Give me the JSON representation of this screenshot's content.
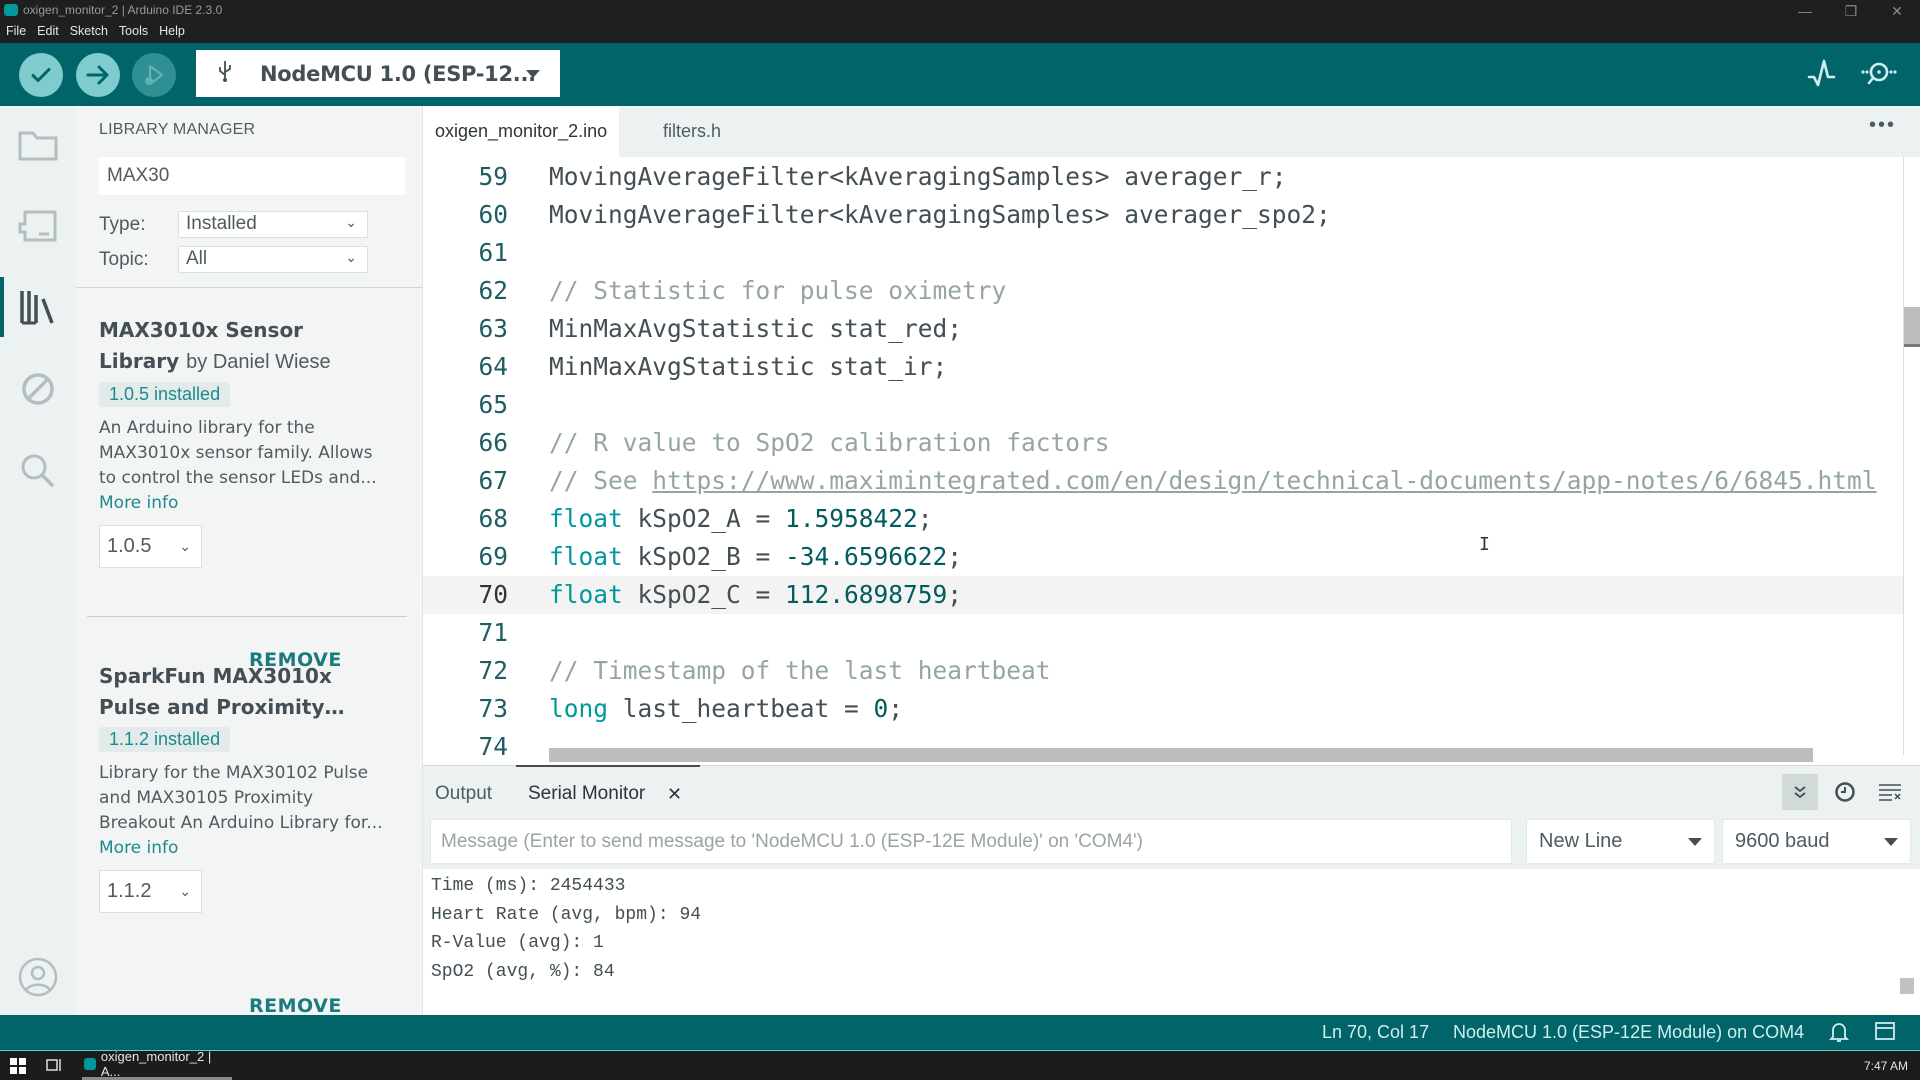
{
  "window": {
    "title": "oxigen_monitor_2 | Arduino IDE 2.3.0",
    "menu": [
      "File",
      "Edit",
      "Sketch",
      "Tools",
      "Help"
    ],
    "controls": {
      "minimize": "—",
      "maximize": "❐",
      "close": "✕"
    }
  },
  "toolbar": {
    "verify_icon": "checkmark-icon",
    "upload_icon": "arrow-right-icon",
    "debug_icon": "debug-icon",
    "board_selector": "NodeMCU 1.0 (ESP-12...",
    "serial_plotter_icon": "pulse-icon",
    "serial_monitor_icon": "serial-monitor-icon"
  },
  "activity_bar": {
    "items": [
      "sketchbook",
      "boards-manager",
      "library-manager",
      "debug",
      "search"
    ],
    "active": "library-manager",
    "bottom": "profile"
  },
  "library_manager": {
    "header": "LIBRARY MANAGER",
    "search_value": "MAX30",
    "type_label": "Type:",
    "type_value": "Installed",
    "topic_label": "Topic:",
    "topic_value": "All",
    "libraries": [
      {
        "name": "MAX3010x Sensor Library",
        "name_line1": "MAX3010x Sensor",
        "name_line2": "Library",
        "by": "by Daniel Wiese",
        "badge": "1.0.5 installed",
        "desc_lines": [
          "An Arduino library for the",
          "MAX3010x sensor family. Allows",
          "to control the sensor LEDs and..."
        ],
        "more_info": "More info",
        "version": "1.0.5",
        "action": "REMOVE"
      },
      {
        "name": "SparkFun MAX3010x Pulse and Proximity…",
        "name_line1": "SparkFun MAX3010x",
        "name_line2": "Pulse and Proximity…",
        "by": "",
        "badge": "1.1.2 installed",
        "desc_lines": [
          "Library for the MAX30102 Pulse",
          "and MAX30105 Proximity",
          "Breakout An Arduino Library for..."
        ],
        "more_info": "More info",
        "version": "1.1.2",
        "action": "REMOVE"
      }
    ]
  },
  "editor": {
    "tabs": [
      {
        "label": "oxigen_monitor_2.ino",
        "active": true
      },
      {
        "label": "filters.h",
        "active": false
      }
    ],
    "more_icon": "more-horizontal-icon",
    "current_line": 70,
    "lines": [
      {
        "n": "59",
        "tokens": [
          [
            "",
            "MovingAverageFilter<kAveragingSamples> averager_r;"
          ]
        ]
      },
      {
        "n": "60",
        "tokens": [
          [
            "",
            "MovingAverageFilter<kAveragingSamples> averager_spo2;"
          ]
        ]
      },
      {
        "n": "61",
        "tokens": []
      },
      {
        "n": "62",
        "tokens": [
          [
            "cm",
            "// Statistic for pulse oximetry"
          ]
        ]
      },
      {
        "n": "63",
        "tokens": [
          [
            "",
            "MinMaxAvgStatistic stat_red;"
          ]
        ]
      },
      {
        "n": "64",
        "tokens": [
          [
            "",
            "MinMaxAvgStatistic stat_ir;"
          ]
        ]
      },
      {
        "n": "65",
        "tokens": []
      },
      {
        "n": "66",
        "tokens": [
          [
            "cm",
            "// R value to SpO2 calibration factors"
          ]
        ]
      },
      {
        "n": "67",
        "tokens": [
          [
            "cm",
            "// See "
          ],
          [
            "url",
            "https://www.maximintegrated.com/en/design/technical-documents/app-notes/6/6845.html"
          ]
        ]
      },
      {
        "n": "68",
        "tokens": [
          [
            "kw",
            "float"
          ],
          [
            "",
            " kSpO2_A = "
          ],
          [
            "num",
            "1.5958422"
          ],
          [
            "",
            ";"
          ]
        ]
      },
      {
        "n": "69",
        "tokens": [
          [
            "kw",
            "float"
          ],
          [
            "",
            " kSpO2_B = "
          ],
          [
            "num",
            "-34.6596622"
          ],
          [
            "",
            ";"
          ]
        ]
      },
      {
        "n": "70",
        "tokens": [
          [
            "kw",
            "float"
          ],
          [
            "",
            " kSpO2_C = "
          ],
          [
            "num",
            "112.6898759"
          ],
          [
            "",
            ";"
          ]
        ]
      },
      {
        "n": "71",
        "tokens": []
      },
      {
        "n": "72",
        "tokens": [
          [
            "cm",
            "// Timestamp of the last heartbeat"
          ]
        ]
      },
      {
        "n": "73",
        "tokens": [
          [
            "kw",
            "long"
          ],
          [
            "",
            " last_heartbeat = "
          ],
          [
            "num",
            "0"
          ],
          [
            "",
            ";"
          ]
        ]
      },
      {
        "n": "74",
        "tokens": []
      }
    ]
  },
  "panel": {
    "tabs": [
      {
        "label": "Output",
        "active": false
      },
      {
        "label": "Serial Monitor",
        "active": true
      }
    ],
    "close_label": "×",
    "icons": [
      "autoscroll-icon",
      "timestamp-icon",
      "clear-output-icon"
    ],
    "message_placeholder": "Message (Enter to send message to 'NodeMCU 1.0 (ESP-12E Module)' on 'COM4')",
    "line_ending": "New Line",
    "baud_rate": "9600 baud",
    "serial_output": [
      "Time (ms): 2454433",
      "Heart Rate (avg, bpm): 94",
      "R-Value (avg): 1",
      "SpO2 (avg, %): 84"
    ]
  },
  "status_bar": {
    "position": "Ln 70, Col 17",
    "board": "NodeMCU 1.0 (ESP-12E Module) on COM4"
  },
  "taskbar": {
    "app_label": "oxigen_monitor_2 | A...",
    "clock": "7:47 AM"
  },
  "colors": {
    "brand_teal": "#006468",
    "keyword": "#00979d",
    "number": "#005c5f",
    "comment": "#95a5a6"
  }
}
